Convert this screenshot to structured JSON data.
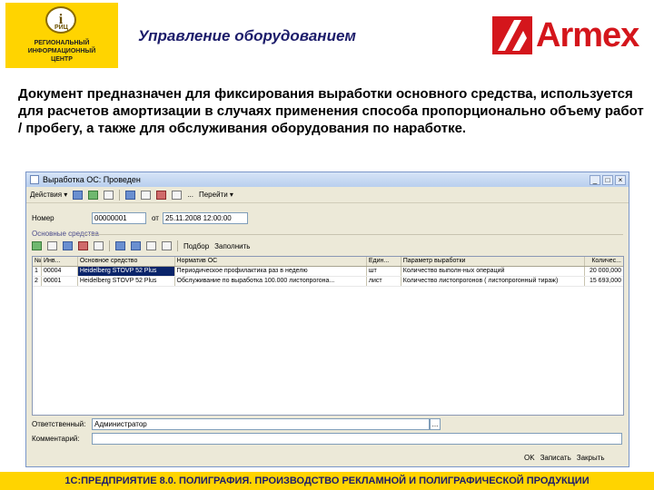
{
  "header": {
    "logo_glyph": "i",
    "logo_abbr": "РИЦ",
    "logo_text": "РЕГИОНАЛЬНЫЙ\nИНФОРМАЦИОННЫЙ\nЦЕНТР",
    "title": "Управление оборудованием",
    "brand": "Armex"
  },
  "description": "Документ предназначен для фиксирования выработки основного средства, используется для расчетов амортизации в случаях применения способа пропорционально объему работ / пробегу, а также для обслуживания оборудования по наработке.",
  "window": {
    "title": "Выработка ОС: Проведен",
    "controls": [
      "_",
      "□",
      "×"
    ],
    "toolbar": {
      "actions_label": "Действия ▾",
      "ellipsis": "...",
      "more_label": "Перейти ▾"
    },
    "number_label": "Номер",
    "number_value": "00000001",
    "date_label": "от",
    "date_value": "25.11.2008 12:00:00",
    "section_title": "Основные средства",
    "grid_toolbar": {
      "select_label": "Подбор",
      "fill_label": "Заполнить"
    },
    "columns": [
      "№",
      "Инв...",
      "Основное средство",
      "Норматив ОС",
      "Един...",
      "Параметр выработки",
      "Количес..."
    ],
    "rows": [
      [
        "1",
        "00004",
        "Heidelberg STOVP 52 Plus",
        "Периодическое профилактика раз в неделю",
        "шт",
        "Количество выполн-ных операций",
        "20 000,000"
      ],
      [
        "2",
        "00001",
        "Heidelberg STOVP 52 Plus",
        "Обслуживание по выработка 100.000 листопрогона...",
        "лист",
        "Количество листопрогонов ( листопрогонный тираж)",
        "15 693,000"
      ]
    ],
    "responsible_label": "Ответственный:",
    "responsible_value": "Администратор",
    "comment_label": "Комментарий:",
    "buttons": {
      "ok": "OK",
      "write": "Записать",
      "close": "Закрыть"
    }
  },
  "footer_text": "1С:ПРЕДПРИЯТИЕ 8.0. ПОЛИГРАФИЯ. ПРОИЗВОДСТВО РЕКЛАМНОЙ И ПОЛИГРАФИЧЕСКОЙ ПРОДУКЦИИ",
  "colors": {
    "accent_yellow": "#ffd400",
    "brand_red": "#d4161c",
    "title_navy": "#1c1c6a"
  }
}
